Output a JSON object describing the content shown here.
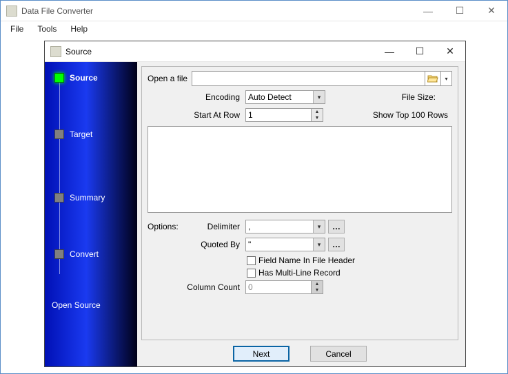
{
  "app": {
    "title": "Data File Converter"
  },
  "menu": {
    "file": "File",
    "tools": "Tools",
    "help": "Help"
  },
  "dialog": {
    "title": "Source"
  },
  "steps": {
    "s0": "Source",
    "s1": "Target",
    "s2": "Summary",
    "s3": "Convert"
  },
  "hint": "Open Source",
  "labels": {
    "openfile": "Open a file",
    "encoding": "Encoding",
    "filesize": "File Size:",
    "startrow": "Start At Row",
    "showtop": "Show Top 100 Rows",
    "options": "Options:",
    "delimiter": "Delimiter",
    "quotedby": "Quoted By",
    "fieldname": "Field Name In File Header",
    "multiline": "Has Multi-Line Record",
    "colcount": "Column Count"
  },
  "values": {
    "path": "",
    "encoding": "Auto Detect",
    "startrow": "1",
    "delimiter": ",",
    "quotedby": "\"",
    "colcount": "0"
  },
  "buttons": {
    "next": "Next",
    "cancel": "Cancel"
  }
}
